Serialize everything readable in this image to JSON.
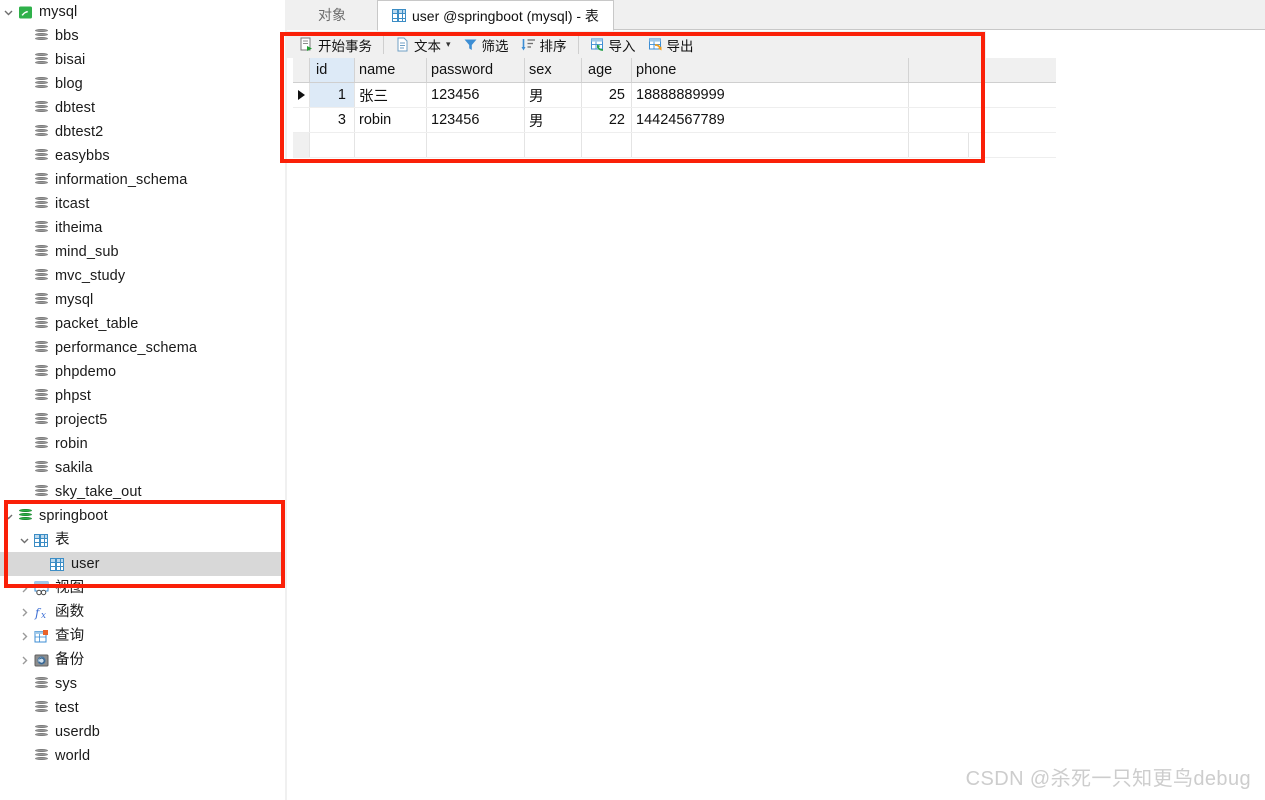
{
  "sidebar": {
    "connection": {
      "label": "mysql",
      "icon": "mysql-connection-icon",
      "expanded": true
    },
    "databases": [
      {
        "label": "bbs"
      },
      {
        "label": "bisai"
      },
      {
        "label": "blog"
      },
      {
        "label": "dbtest"
      },
      {
        "label": "dbtest2"
      },
      {
        "label": "easybbs"
      },
      {
        "label": "information_schema"
      },
      {
        "label": "itcast"
      },
      {
        "label": "itheima"
      },
      {
        "label": "mind_sub"
      },
      {
        "label": "mvc_study"
      },
      {
        "label": "mysql"
      },
      {
        "label": "packet_table"
      },
      {
        "label": "performance_schema"
      },
      {
        "label": "phpdemo"
      },
      {
        "label": "phpst"
      },
      {
        "label": "project5"
      },
      {
        "label": "robin"
      },
      {
        "label": "sakila"
      },
      {
        "label": "sky_take_out"
      }
    ],
    "active_db": {
      "label": "springboot",
      "expanded": true
    },
    "active_db_children": [
      {
        "label": "表",
        "icon": "table-icon",
        "expanded": true
      },
      {
        "label": "视图",
        "icon": "view-icon",
        "expanded": false
      },
      {
        "label": "函数",
        "icon": "function-icon",
        "expanded": false
      },
      {
        "label": "查询",
        "icon": "query-icon",
        "expanded": false
      },
      {
        "label": "备份",
        "icon": "backup-icon",
        "expanded": false
      }
    ],
    "selected_table": {
      "label": "user",
      "icon": "table-icon"
    },
    "databases_after": [
      {
        "label": "sys"
      },
      {
        "label": "test"
      },
      {
        "label": "userdb"
      },
      {
        "label": "world"
      }
    ]
  },
  "tabs": {
    "objects_tab": "对象",
    "active_tab": "user @springboot (mysql) - 表"
  },
  "toolbar": {
    "begin_transaction": "开始事务",
    "text": "文本",
    "filter": "筛选",
    "sort": "排序",
    "import": "导入",
    "export": "导出"
  },
  "grid": {
    "columns": [
      "id",
      "name",
      "password",
      "sex",
      "age",
      "phone"
    ],
    "rows": [
      {
        "selected": true,
        "id": "1",
        "name": "张三",
        "password": "123456",
        "sex": "男",
        "age": "25",
        "phone": "18888889999"
      },
      {
        "selected": false,
        "id": "3",
        "name": "robin",
        "password": "123456",
        "sex": "男",
        "age": "22",
        "phone": "14424567789"
      }
    ]
  },
  "watermark": "CSDN @杀死一只知更鸟debug",
  "colors": {
    "annotation_red": "#fa2008",
    "selection_grey": "#d8d8d8",
    "header_blue": "#ddeaf7",
    "db_green": "#2fb14a"
  }
}
